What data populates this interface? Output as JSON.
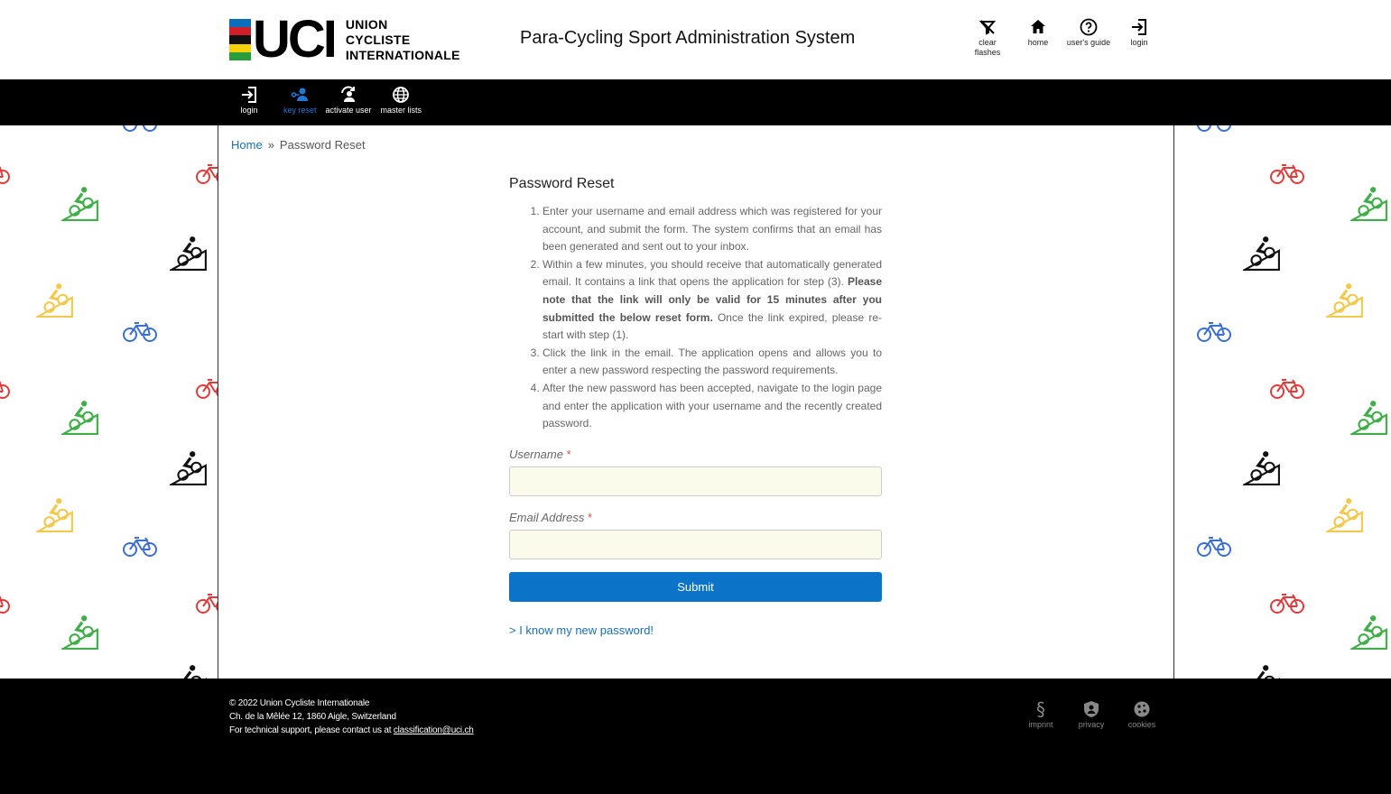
{
  "header": {
    "logo_mark": "UCI",
    "logo_lines": [
      "UNION",
      "CYCLISTE",
      "INTERNATIONALE"
    ],
    "logo_colors": [
      "#0a6ebd",
      "#d11f2a",
      "#111111",
      "#f5d10c",
      "#2a9d3b"
    ],
    "app_title": "Para-Cycling Sport Administration System",
    "icons": [
      {
        "name": "clear-flashes",
        "label": "clear flashes",
        "icon": "clear-flashes-icon"
      },
      {
        "name": "home",
        "label": "home",
        "icon": "home-icon"
      },
      {
        "name": "users-guide",
        "label": "user's guide",
        "icon": "help-icon"
      },
      {
        "name": "login",
        "label": "login",
        "icon": "login-icon"
      }
    ]
  },
  "nav": {
    "items": [
      {
        "label": "login",
        "icon": "login-icon",
        "active": false
      },
      {
        "label": "key reset",
        "icon": "key-reset-icon",
        "active": true
      },
      {
        "label": "activate user",
        "icon": "activate-user-icon",
        "active": false
      },
      {
        "label": "master lists",
        "icon": "globe-icon",
        "active": false
      }
    ],
    "accent": "#1e7ad6"
  },
  "breadcrumb": {
    "home": "Home",
    "separator": "»",
    "current": "Password Reset"
  },
  "page": {
    "title": "Password Reset",
    "steps": [
      {
        "text": "Enter your username and email address which was registered for your account, and submit the form. The system confirms that an email has been generated and sent out to your inbox."
      },
      {
        "pre": "Within a few minutes, you should receive that automatically generated email. It contains a link that opens the application for step (3). ",
        "bold": "Please note that the link will only be valid for 15 minutes after you submitted the below reset form.",
        "post": " Once the link expired, please re-start with step (1)."
      },
      {
        "text": "Click the link in the email. The application opens and allows you to enter a new password respecting the password requirements."
      },
      {
        "text": "After the new password has been accepted, navigate to the login page and enter the application with your username and the recently created password."
      }
    ],
    "username_label": "Username",
    "username_value": "",
    "email_label": "Email Address",
    "email_value": "",
    "required_mark": "*",
    "submit_label": "Submit",
    "know_password_link": "> I know my new password!"
  },
  "footer": {
    "copyright": "© 2022 Union Cycliste Internationale",
    "address": "Ch. de la Mêlée 12, 1860 Aigle, Switzerland",
    "support_prefix": "For technical support, please contact us at ",
    "support_email": "classification@uci.ch",
    "icons": [
      {
        "label": "imprint",
        "icon": "section-icon"
      },
      {
        "label": "privacy",
        "icon": "shield-icon"
      },
      {
        "label": "cookies",
        "icon": "cookie-icon"
      }
    ]
  },
  "colors": {
    "primary_button": "#0b74c9",
    "link": "#1a6fb5",
    "input_bg": "#fbfbeb",
    "bike_red": "#e23b3b",
    "bike_green": "#3fae49",
    "bike_black": "#111111",
    "bike_yellow": "#f2c94c",
    "bike_blue": "#3b6fd4"
  }
}
